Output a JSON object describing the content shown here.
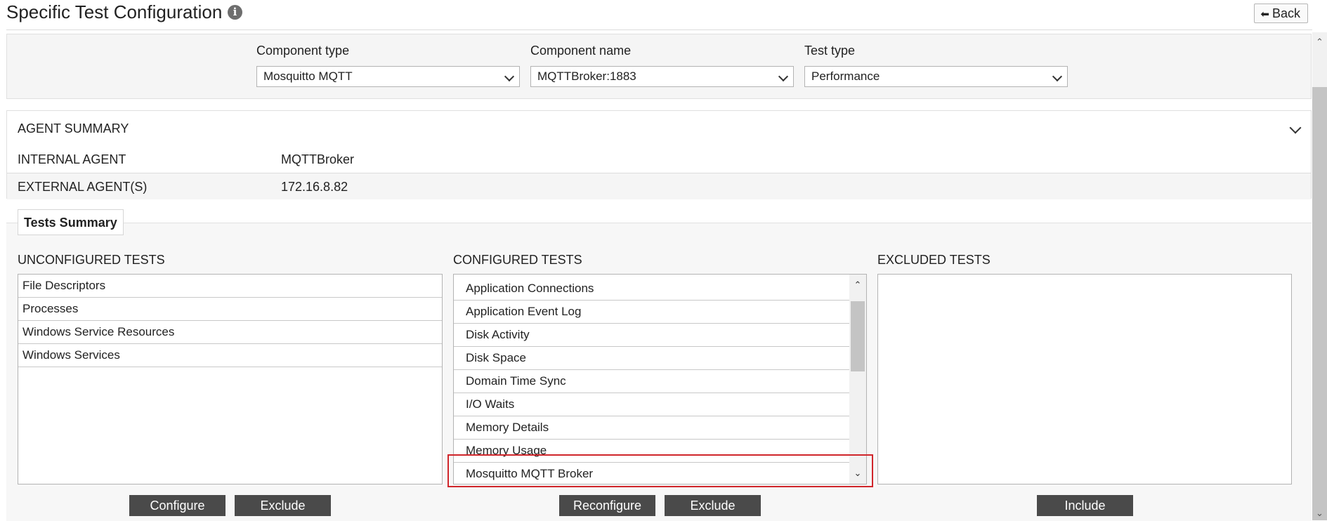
{
  "header": {
    "title": "Specific Test Configuration",
    "info_icon": "i",
    "back_label": "Back",
    "back_icon": "reply-arrow-icon"
  },
  "selectors": {
    "component_type": {
      "label": "Component type",
      "value": "Mosquitto MQTT"
    },
    "component_name": {
      "label": "Component name",
      "value": "MQTTBroker:1883"
    },
    "test_type": {
      "label": "Test type",
      "value": "Performance"
    }
  },
  "agent_summary": {
    "title": "AGENT SUMMARY",
    "rows": [
      {
        "key": "INTERNAL AGENT",
        "value": "MQTTBroker"
      },
      {
        "key": "EXTERNAL AGENT(S)",
        "value": "172.16.8.82"
      }
    ]
  },
  "tests_summary": {
    "tab_label": "Tests Summary",
    "unconfigured": {
      "title": "UNCONFIGURED TESTS",
      "items": [
        "File Descriptors",
        "Processes",
        "Windows Service Resources",
        "Windows Services"
      ],
      "buttons": {
        "configure": "Configure",
        "exclude": "Exclude"
      }
    },
    "configured": {
      "title": "CONFIGURED TESTS",
      "items": [
        "Application Connections",
        "Application Event Log",
        "Disk Activity",
        "Disk Space",
        "Domain Time Sync",
        "I/O Waits",
        "Memory Details",
        "Memory Usage",
        "Mosquitto MQTT Broker"
      ],
      "highlighted_item": "Mosquitto MQTT Broker",
      "buttons": {
        "reconfigure": "Reconfigure",
        "exclude": "Exclude"
      }
    },
    "excluded": {
      "title": "EXCLUDED TESTS",
      "items": [],
      "buttons": {
        "include": "Include"
      }
    }
  },
  "colors": {
    "highlight": "#d0262b",
    "button_bg": "#4a4a4a",
    "panel_bg": "#f5f5f5"
  }
}
